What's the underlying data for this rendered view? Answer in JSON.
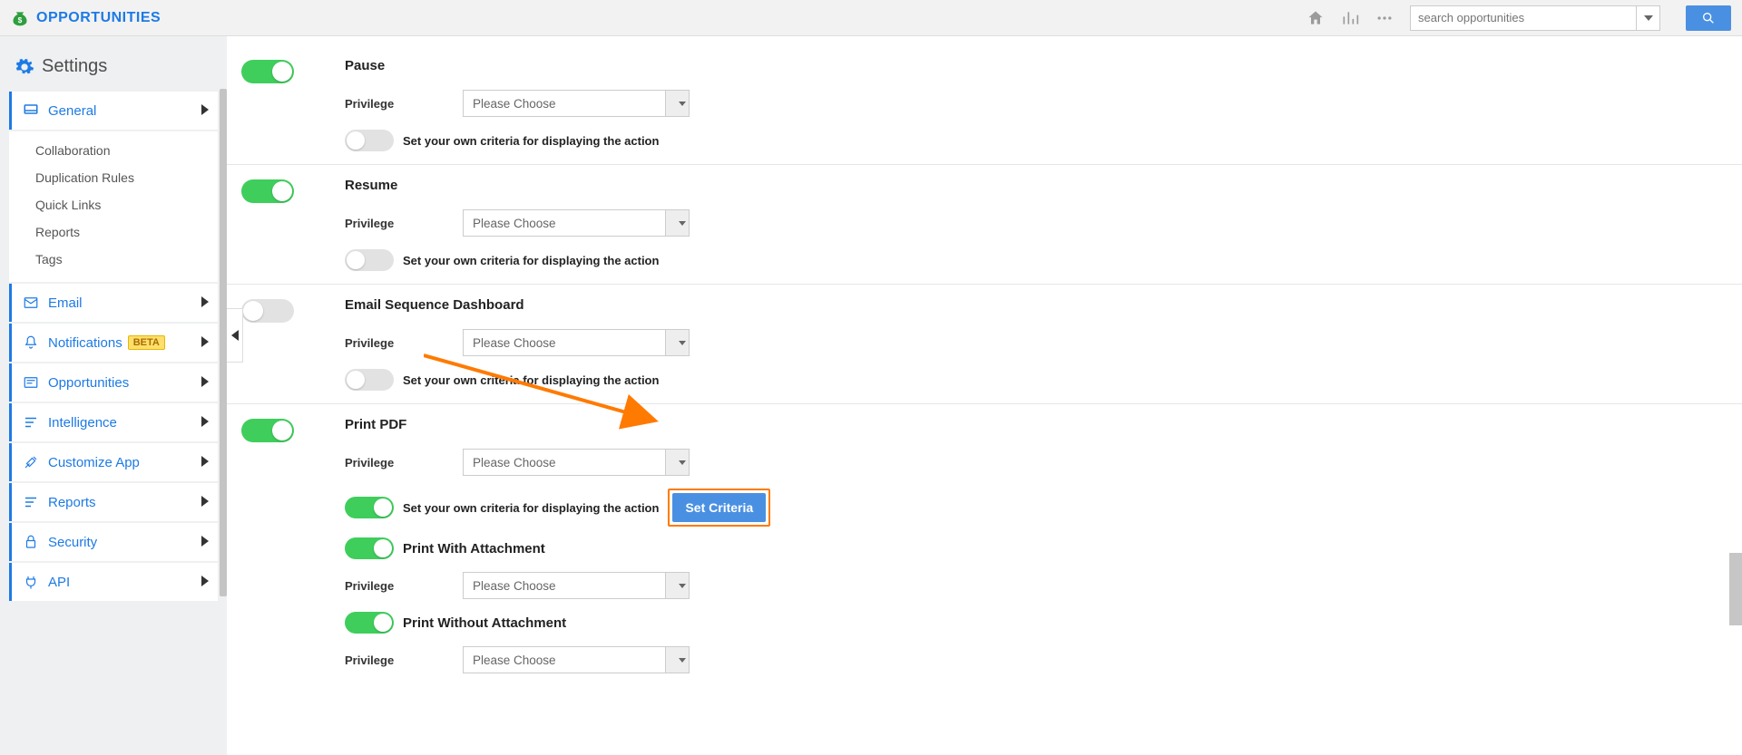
{
  "header": {
    "brand": "OPPORTUNITIES",
    "search_placeholder": "search opportunities"
  },
  "sidebar": {
    "title": "Settings",
    "general": {
      "label": "General"
    },
    "general_sub": [
      "Collaboration",
      "Duplication Rules",
      "Quick Links",
      "Reports",
      "Tags"
    ],
    "email": {
      "label": "Email"
    },
    "notifications": {
      "label": "Notifications",
      "badge": "BETA"
    },
    "opportunities": {
      "label": "Opportunities"
    },
    "intelligence": {
      "label": "Intelligence"
    },
    "customize": {
      "label": "Customize App"
    },
    "reports": {
      "label": "Reports"
    },
    "security": {
      "label": "Security"
    },
    "api": {
      "label": "API"
    }
  },
  "labels": {
    "privilege": "Privilege",
    "please_choose": "Please Choose",
    "criteria_text": "Set your own criteria for displaying the action",
    "set_criteria_btn": "Set Criteria"
  },
  "rows": {
    "pause": {
      "title": "Pause"
    },
    "resume": {
      "title": "Resume"
    },
    "dashboard": {
      "title": "Email Sequence Dashboard"
    },
    "printpdf": {
      "title": "Print PDF"
    },
    "with_att": {
      "title": "Print With Attachment"
    },
    "without_att": {
      "title": "Print Without Attachment"
    }
  }
}
